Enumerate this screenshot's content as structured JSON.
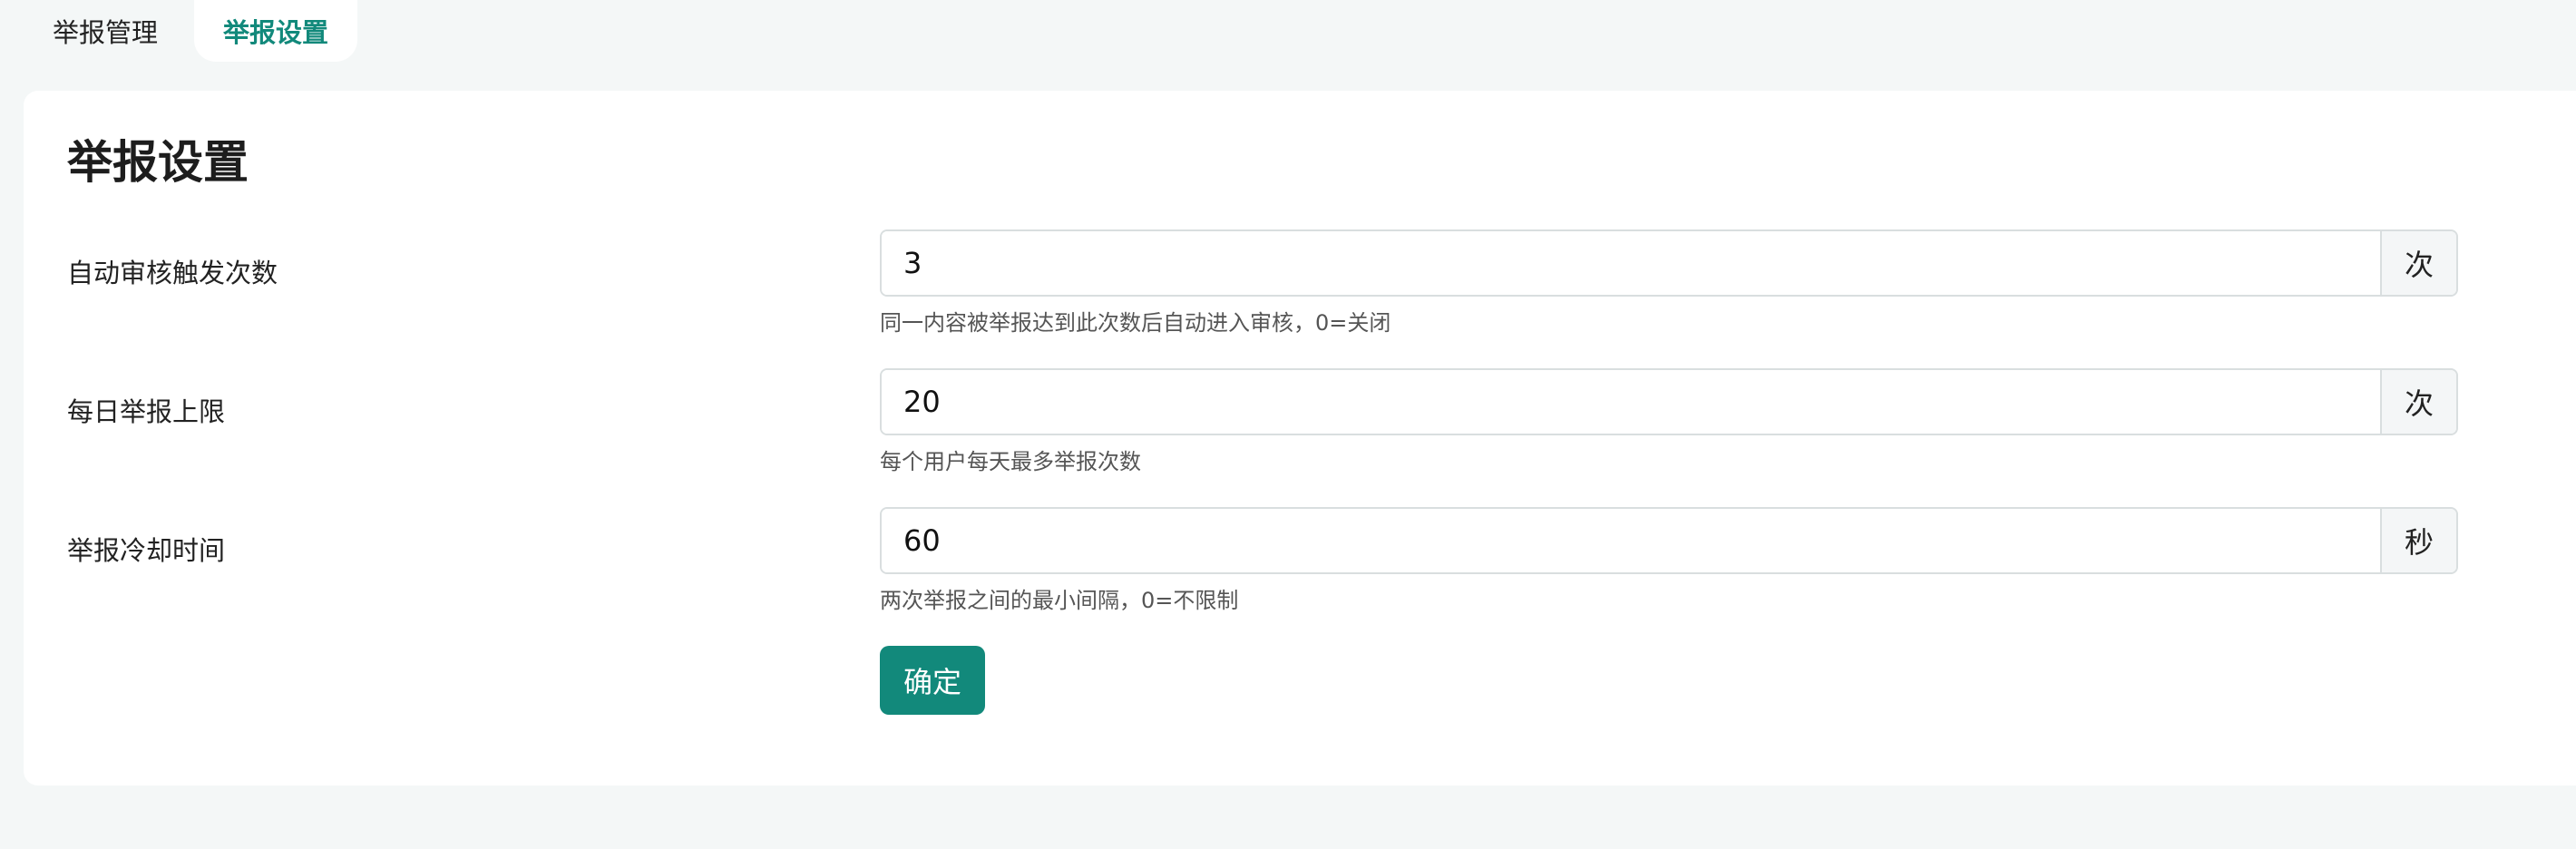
{
  "tabs": [
    {
      "label": "举报管理",
      "active": false
    },
    {
      "label": "举报设置",
      "active": true
    }
  ],
  "settings": {
    "title": "举报设置",
    "fields": [
      {
        "label": "自动审核触发次数",
        "value": "3",
        "unit": "次",
        "hint": "同一内容被举报达到此次数后自动进入审核，0=关闭"
      },
      {
        "label": "每日举报上限",
        "value": "20",
        "unit": "次",
        "hint": "每个用户每天最多举报次数"
      },
      {
        "label": "举报冷却时间",
        "value": "60",
        "unit": "秒",
        "hint": "两次举报之间的最小间隔，0=不限制"
      }
    ],
    "submit_label": "确定"
  },
  "colors": {
    "accent": "#12897b",
    "page_background": "#f4f7f7",
    "card_background": "#ffffff"
  }
}
